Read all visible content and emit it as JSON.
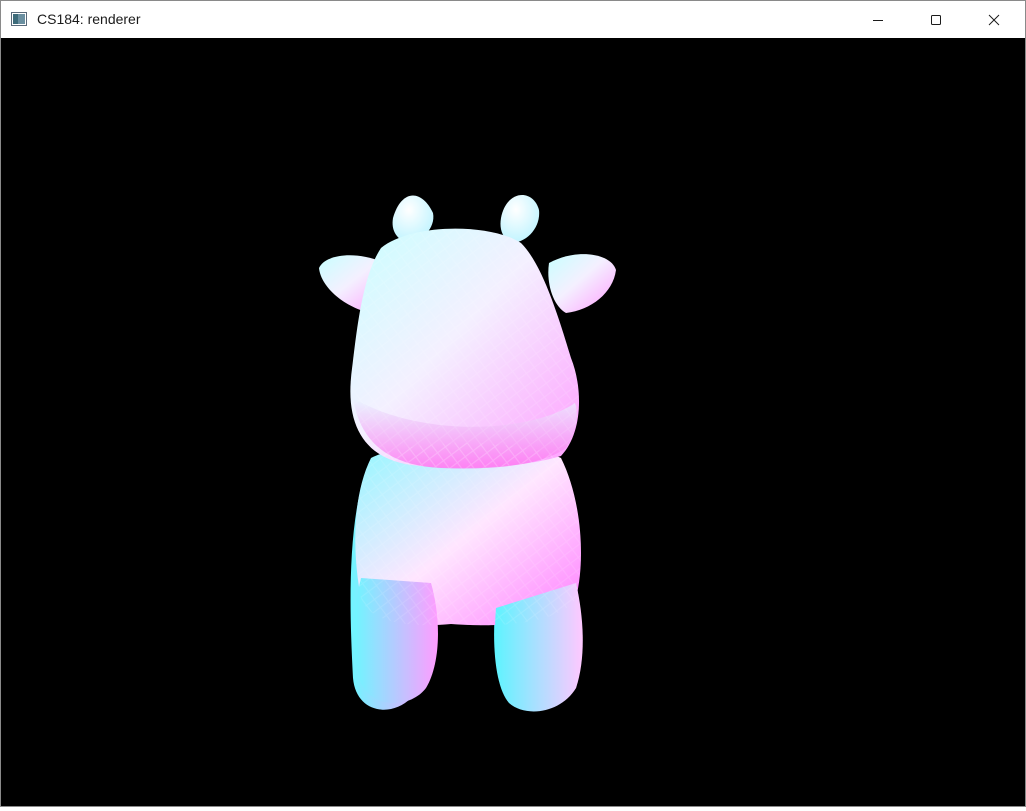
{
  "window": {
    "title": "CS184: renderer",
    "app_icon": "window-app-icon",
    "controls": {
      "minimize_icon": "minimize-icon",
      "maximize_icon": "maximize-icon",
      "close_icon": "close-icon"
    }
  },
  "viewport": {
    "background_color": "#000000",
    "model": "cow-mesh",
    "shading": "normal-shaded"
  }
}
